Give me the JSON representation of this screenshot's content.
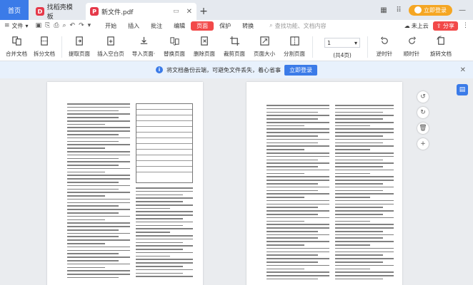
{
  "tabs": {
    "home": "首页",
    "items": [
      {
        "label": "找稻壳模板",
        "logo": "D",
        "active": false
      },
      {
        "label": "新文件.pdf",
        "logo": "P",
        "active": true
      }
    ]
  },
  "titlebar": {
    "login_label": "立即登录"
  },
  "menubar": {
    "file_label": "文件",
    "tabs": [
      "开始",
      "插入",
      "批注",
      "编辑",
      "页面",
      "保护",
      "转换"
    ],
    "active_tab": "页面",
    "search_placeholder": "查找功能、文档内容",
    "cloud_label": "未上云",
    "share_label": "分享"
  },
  "ribbon": {
    "buttons": [
      {
        "id": "merge",
        "label": "合并文档",
        "icon": "merge-icon"
      },
      {
        "id": "split",
        "label": "拆分文档",
        "icon": "split-icon"
      },
      {
        "id": "extract",
        "label": "提取页面",
        "icon": "extract-icon"
      },
      {
        "id": "insert-blank",
        "label": "插入空白页",
        "icon": "insert-blank-icon"
      },
      {
        "id": "import",
        "label": "导入页面·",
        "icon": "import-icon"
      },
      {
        "id": "replace",
        "label": "替换页面",
        "icon": "replace-icon"
      },
      {
        "id": "delete",
        "label": "删除页面",
        "icon": "delete-page-icon"
      },
      {
        "id": "crop",
        "label": "裁剪页面",
        "icon": "crop-icon"
      },
      {
        "id": "size",
        "label": "页面大小",
        "icon": "page-size-icon"
      },
      {
        "id": "split-page",
        "label": "分割页面",
        "icon": "split-page-icon"
      }
    ],
    "page_field": "1",
    "page_total": "(共4页)",
    "rotate_buttons": [
      {
        "id": "ccw",
        "label": "逆时针"
      },
      {
        "id": "cw",
        "label": "顺时针"
      },
      {
        "id": "rotate-doc",
        "label": "旋转文档"
      }
    ]
  },
  "notice": {
    "text": "将文档备份云端，可避免文件丢失，着心省事",
    "button": "立即登录"
  },
  "colors": {
    "accent_blue": "#3b7be8",
    "accent_red": "#f24949",
    "login_orange": "#f5a623"
  }
}
